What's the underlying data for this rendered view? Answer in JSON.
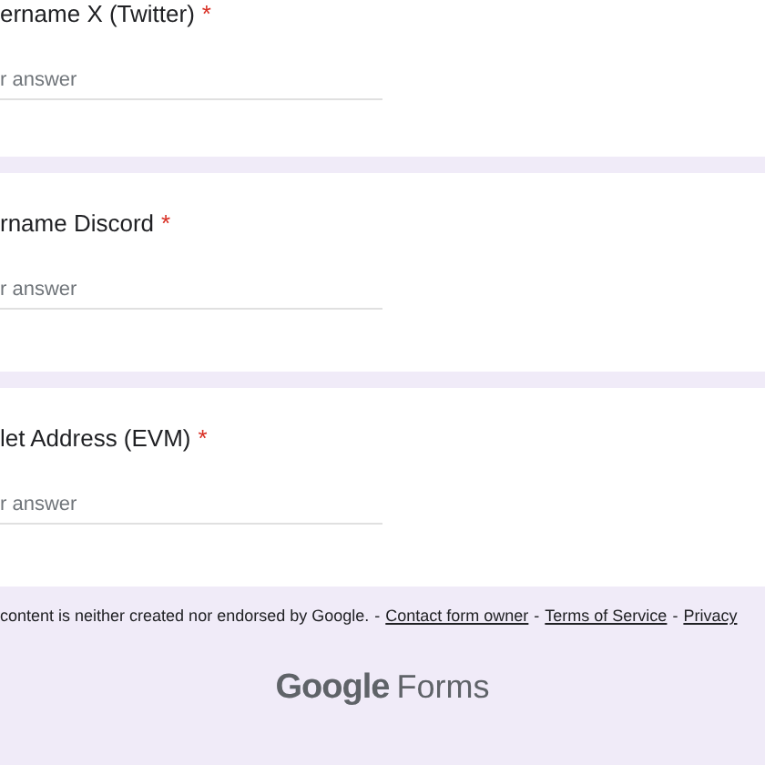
{
  "questions": [
    {
      "title": "ername X (Twitter)",
      "required": true,
      "required_mark": "*",
      "placeholder": "r answer"
    },
    {
      "title": "rname Discord",
      "required": true,
      "required_mark": "*",
      "placeholder": "r answer"
    },
    {
      "title": "let Address (EVM)",
      "required": true,
      "required_mark": "*",
      "placeholder": "r answer"
    }
  ],
  "footer": {
    "notice": "content is neither created nor endorsed by Google.",
    "links": [
      "Contact form owner",
      "Terms of Service",
      "Privacy"
    ],
    "separator": "-"
  },
  "logo": {
    "brand": "Google",
    "product": "Forms"
  }
}
